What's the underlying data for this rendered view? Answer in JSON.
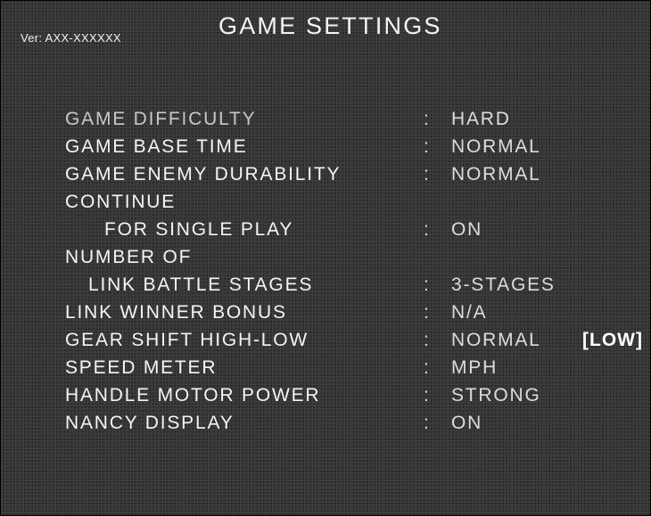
{
  "header": {
    "version": "Ver: AXX-XXXXXX",
    "title": "GAME SETTINGS"
  },
  "settings": [
    {
      "label": "GAME DIFFICULTY",
      "colon": ":",
      "value": "HARD"
    },
    {
      "label": "GAME BASE TIME",
      "colon": ":",
      "value": "NORMAL"
    },
    {
      "label": "GAME ENEMY DURABILITY",
      "colon": ":",
      "value": "NORMAL"
    },
    {
      "label": "CONTINUE"
    },
    {
      "label": "FOR SINGLE PLAY",
      "colon": ":",
      "value": "ON"
    },
    {
      "label": "NUMBER OF"
    },
    {
      "label": "LINK BATTLE STAGES",
      "colon": ":",
      "value": "3-STAGES"
    },
    {
      "label": "LINK WINNER BONUS",
      "colon": ":",
      "value": "N/A"
    },
    {
      "label": "GEAR SHIFT HIGH-LOW",
      "colon": ":",
      "value": "NORMAL",
      "extra": "[LOW]"
    },
    {
      "label": "SPEED METER",
      "colon": ":",
      "value": "MPH"
    },
    {
      "label": "HANDLE MOTOR POWER",
      "colon": ":",
      "value": "STRONG"
    },
    {
      "label": "NANCY DISPLAY",
      "colon": ":",
      "value": "ON"
    }
  ]
}
